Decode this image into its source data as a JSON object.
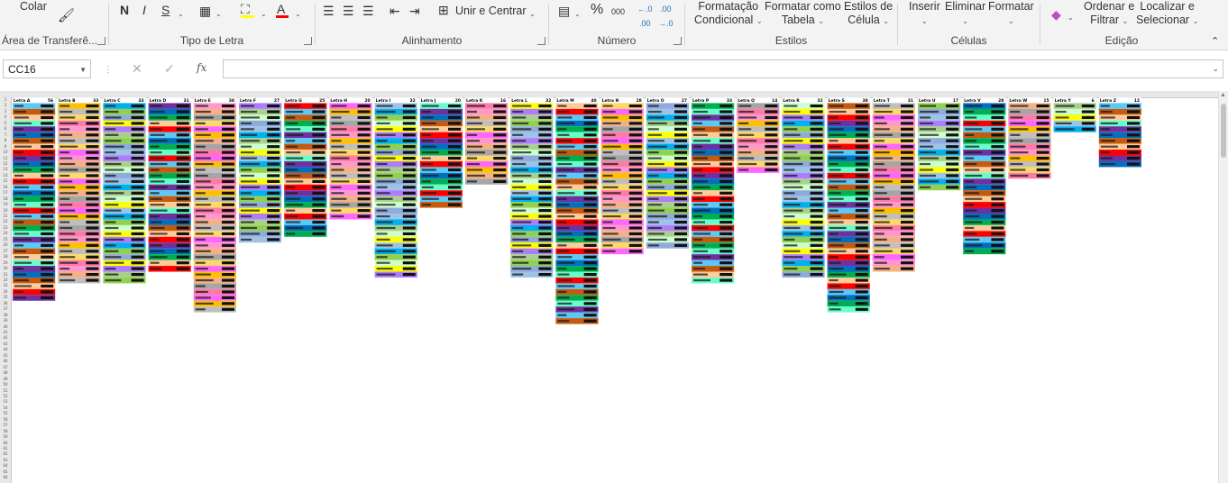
{
  "ribbon": {
    "clipboard": {
      "paste_label": "Colar",
      "group_label": "Área de Transferê..."
    },
    "font": {
      "bold": "N",
      "italic": "I",
      "underline": "S",
      "group_label": "Tipo de Letra"
    },
    "alignment": {
      "merge_label": "Unir e Centrar",
      "group_label": "Alinhamento"
    },
    "number": {
      "percent": "%",
      "thousands": "000",
      "group_label": "Número"
    },
    "styles": {
      "conditional": [
        "Formatação",
        "Condicional"
      ],
      "table": [
        "Formatar como",
        "Tabela"
      ],
      "cell": [
        "Estilos de",
        "Célula"
      ],
      "group_label": "Estilos"
    },
    "cells": {
      "insert": "Inserir",
      "delete": "Eliminar",
      "format": "Formatar",
      "group_label": "Células"
    },
    "editing": {
      "sort": [
        "Ordenar e",
        "Filtrar"
      ],
      "find": [
        "Localizar e",
        "Selecionar"
      ],
      "group_label": "Edição"
    }
  },
  "formula_bar": {
    "name_box": "CC16",
    "fx": "fx",
    "value": ""
  },
  "colors": {
    "accent_red": "#ff0000",
    "highlight_yellow": "#ffff00",
    "palette": [
      "#5bc8f5",
      "#b07cff",
      "#ff7aa8",
      "#00b050",
      "#92d050",
      "#ffc000",
      "#ff0000",
      "#ffff00",
      "#a6a6a6",
      "#0070c0",
      "#00b0f0",
      "#ff66ff",
      "#ffcc99",
      "#ccffcc",
      "#f4b183",
      "#7030a0",
      "#9dc3e6",
      "#ffd966",
      "#c55a11",
      "#a9d18e",
      "#ff99cc",
      "#66ffcc",
      "#8faadc",
      "#bfbfbf"
    ]
  },
  "sheet": {
    "blocks": [
      {
        "header": "Letra A",
        "count": "56",
        "rows": 34
      },
      {
        "header": "Letra B",
        "count": "33",
        "rows": 31
      },
      {
        "header": "Letra C",
        "count": "33",
        "rows": 31
      },
      {
        "header": "Letra D",
        "count": "31",
        "rows": 29
      },
      {
        "header": "Letra E",
        "count": "38",
        "rows": 36
      },
      {
        "header": "Letra F",
        "count": "27",
        "rows": 24
      },
      {
        "header": "Letra G",
        "count": "25",
        "rows": 23
      },
      {
        "header": "Letra H",
        "count": "20",
        "rows": 20
      },
      {
        "header": "Letra I",
        "count": "32",
        "rows": 30
      },
      {
        "header": "Letra J",
        "count": "20",
        "rows": 18
      },
      {
        "header": "Letra K",
        "count": "16",
        "rows": 14
      },
      {
        "header": "Letra L",
        "count": "32",
        "rows": 30
      },
      {
        "header": "Letra M",
        "count": "40",
        "rows": 38
      },
      {
        "header": "Letra N",
        "count": "28",
        "rows": 26
      },
      {
        "header": "Letra O",
        "count": "27",
        "rows": 25
      },
      {
        "header": "Letra P",
        "count": "33",
        "rows": 31
      },
      {
        "header": "Letra Q",
        "count": "14",
        "rows": 12
      },
      {
        "header": "Letra R",
        "count": "32",
        "rows": 30
      },
      {
        "header": "Letra S",
        "count": "38",
        "rows": 36
      },
      {
        "header": "Letra T",
        "count": "31",
        "rows": 29
      },
      {
        "header": "Letra U",
        "count": "17",
        "rows": 15
      },
      {
        "header": "Letra V",
        "count": "28",
        "rows": 26
      },
      {
        "header": "Letra W",
        "count": "15",
        "rows": 13
      },
      {
        "header": "Letra Y",
        "count": "6",
        "rows": 5
      },
      {
        "header": "Letra Z",
        "count": "12",
        "rows": 11
      }
    ]
  }
}
